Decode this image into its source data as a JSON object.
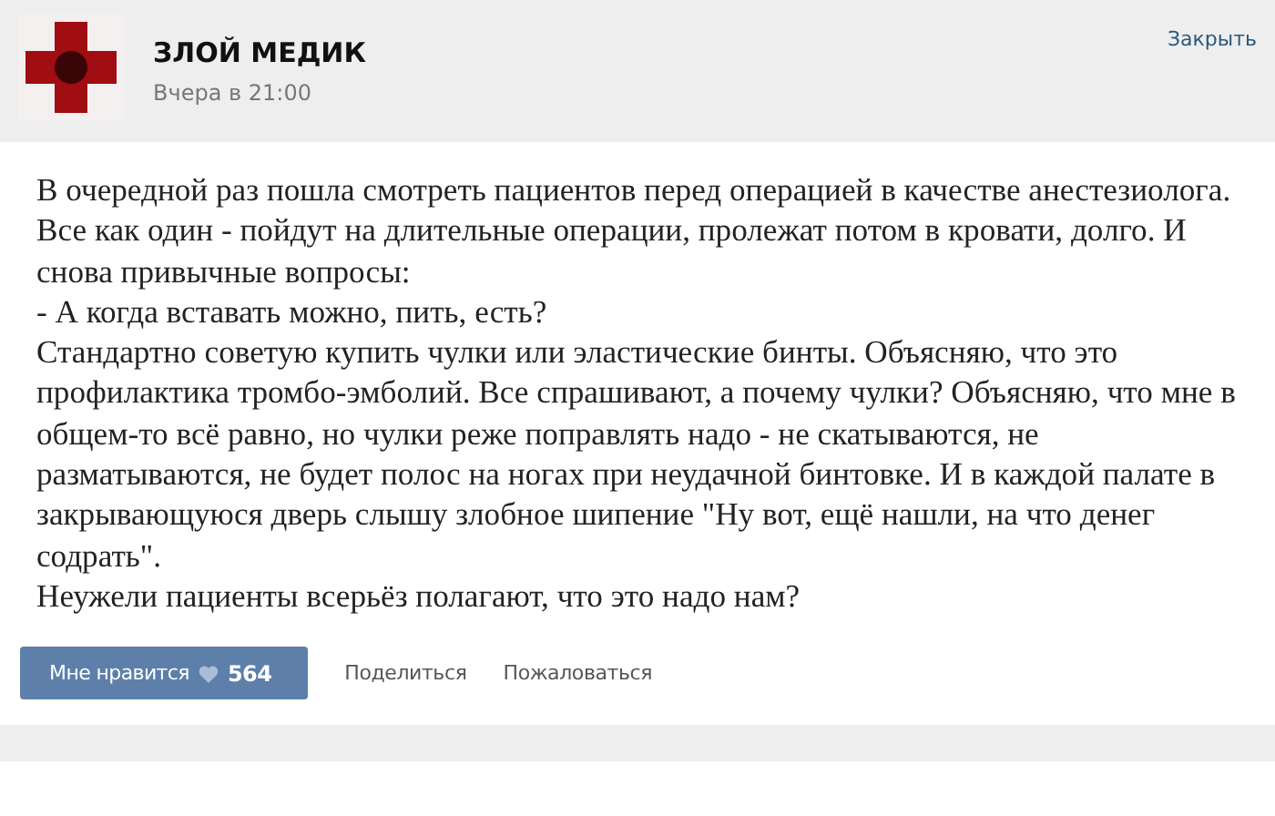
{
  "post": {
    "author": "ЗЛОЙ МЕДИК",
    "time": "Вчера в 21:00",
    "close": "Закрыть"
  },
  "paragraphs": [
    "В очередной раз пошла смотреть пациентов перед операцией в качестве анестезиолога. Все как один - пойдут на длительные операции, пролежат потом в кровати, долго. И снова привычные вопросы:",
    "- А когда вставать можно, пить, есть?",
    "Стандартно советую купить чулки или эластические бинты. Объясняю, что это профилактика тромбо-эмболий. Все спрашивают, а почему чулки? Объясняю, что мне в общем-то всё равно, но чулки реже поправлять надо - не скатываются, не разматываются, не будет полос на ногах при неудачной бинтовке. И в каждой палате в закрывающуюся дверь слышу злобное шипение \"Ну вот, ещё нашли, на что денег содрать\".",
    "Неужели пациенты всерьёз полагают, что это надо нам?"
  ],
  "actions": {
    "like_label": "Мне нравится",
    "like_count": "564",
    "links": [
      "Поделиться",
      "Пожаловаться"
    ]
  }
}
